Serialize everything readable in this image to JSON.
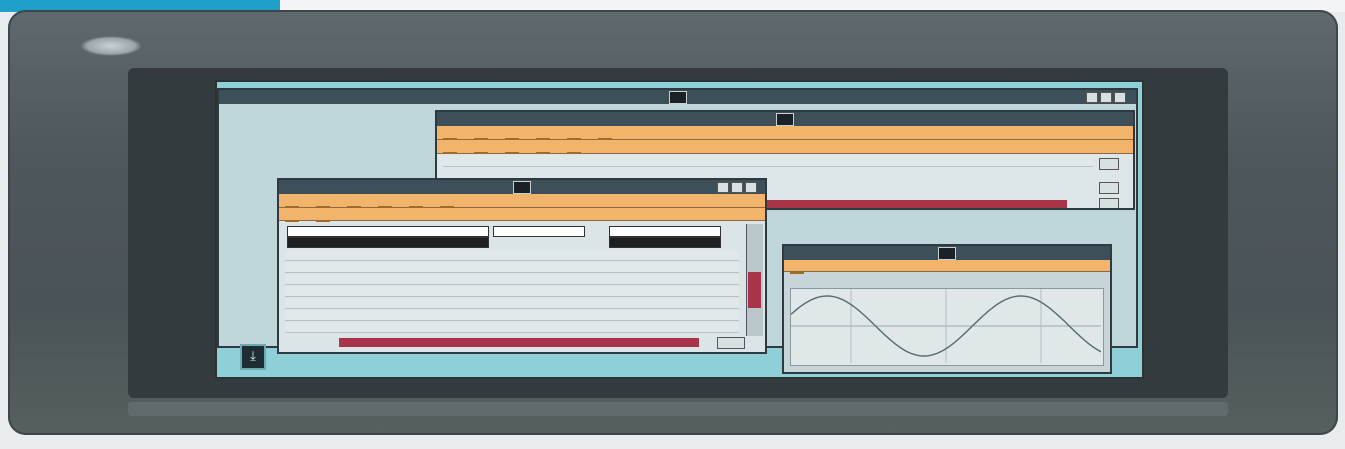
{
  "main_window": {
    "title": "",
    "menu": [
      "",
      "",
      "",
      "",
      "",
      ""
    ],
    "controls": [
      "minimize",
      "maximize",
      "close"
    ]
  },
  "inner_window": {
    "title": "",
    "menu_row1": [
      "",
      "",
      "",
      "",
      "",
      ""
    ],
    "menu_row2": [
      "",
      "",
      "",
      "",
      ""
    ]
  },
  "dialog_window": {
    "title": "",
    "menu_row1": [
      "",
      "",
      "",
      "",
      "",
      ""
    ],
    "menu_row2": [
      "",
      ""
    ],
    "rows": [
      "",
      "",
      "",
      "",
      "",
      "",
      "",
      ""
    ],
    "ok_label": ""
  },
  "graph_window": {
    "title": "",
    "menu": [
      ""
    ],
    "chart_type": "line",
    "waveform": "sine"
  },
  "taskbar": {
    "icon": "app-icon"
  },
  "colors": {
    "desktop": "#8fd0d8",
    "menubar": "#f2b46a",
    "titlebar": "#3d4f58",
    "accent_bar": "#a8344a",
    "bezel": "#4e575b"
  }
}
